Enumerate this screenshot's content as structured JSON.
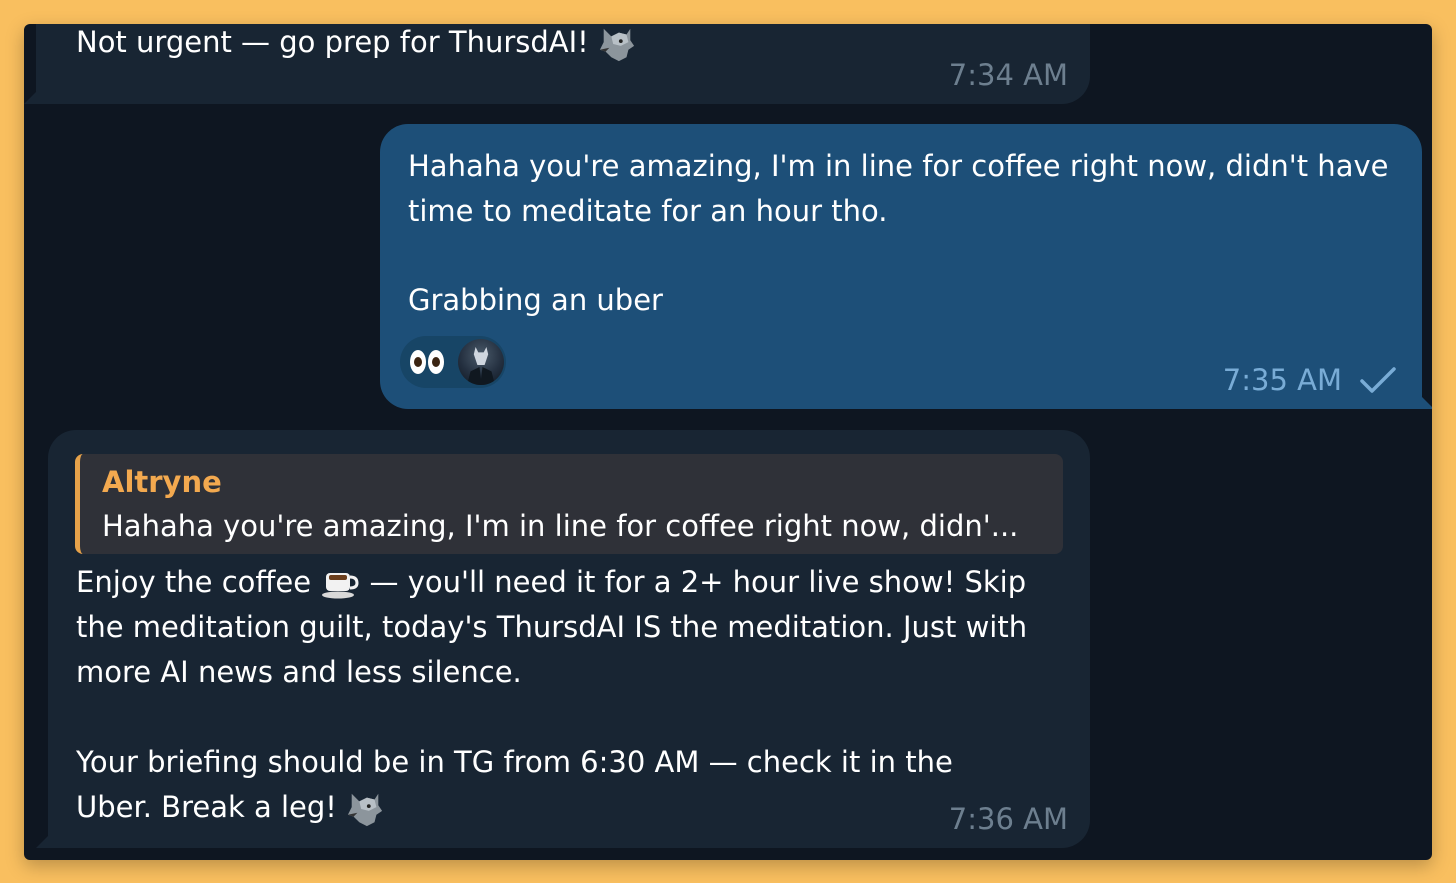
{
  "messages": {
    "msg1": {
      "text": "Not urgent — go prep for ThursdAI!",
      "emoji": "wolf-icon",
      "time": "7:34 AM"
    },
    "msg2": {
      "text_1": "Hahaha you're amazing, I'm in line for coffee right now, didn't have time to meditate for an hour tho.",
      "text_2": "Grabbing an uber",
      "reactions": [
        "eyes-emoji",
        "avatar"
      ],
      "time": "7:35 AM",
      "status_icon": "check-icon"
    },
    "msg3": {
      "reply": {
        "author": "Altryne",
        "text": "Hahaha you're amazing, I'm in line for coffee right now, didn'..."
      },
      "body_1_prefix": "Enjoy the coffee",
      "body_1_suffix": "— you'll need it for a 2+ hour live show! Skip the meditation guilt, today's ThursdAI IS the meditation. Just with more AI news and less silence.",
      "body_2": "Your briefing should be in TG from 6:30 AM — check it in the Uber. Break a leg!",
      "time": "7:36 AM"
    }
  },
  "colors": {
    "frame_background": "#f9bf5f",
    "chat_background": "#0e1621",
    "incoming_bubble": "#182533",
    "outgoing_bubble": "#1d4f78",
    "reply_accent": "#f3a94f",
    "timestamp": "#6d7f8f",
    "outgoing_timestamp": "#79acd6"
  }
}
